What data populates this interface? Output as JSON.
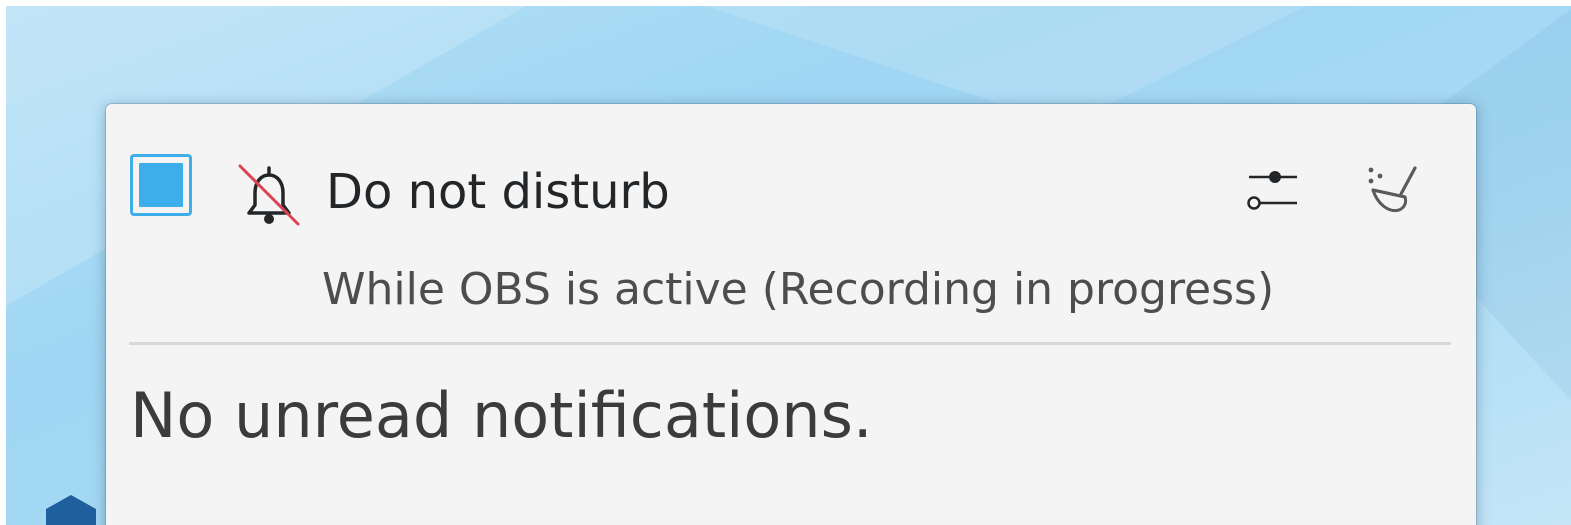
{
  "dnd": {
    "checked": true,
    "label": "Do not disturb",
    "reason": "While OBS is active (Recording in progress)",
    "icon": "notifications-disabled-icon"
  },
  "toolbar": {
    "settings_icon": "configure-sliders-icon",
    "clear_icon": "clear-history-broom-icon"
  },
  "notifications": {
    "empty_message": "No unread notifications."
  },
  "colors": {
    "accent": "#3daee9",
    "strike": "#da4453",
    "panel_bg": "#f4f4f4",
    "text": "#232629"
  }
}
